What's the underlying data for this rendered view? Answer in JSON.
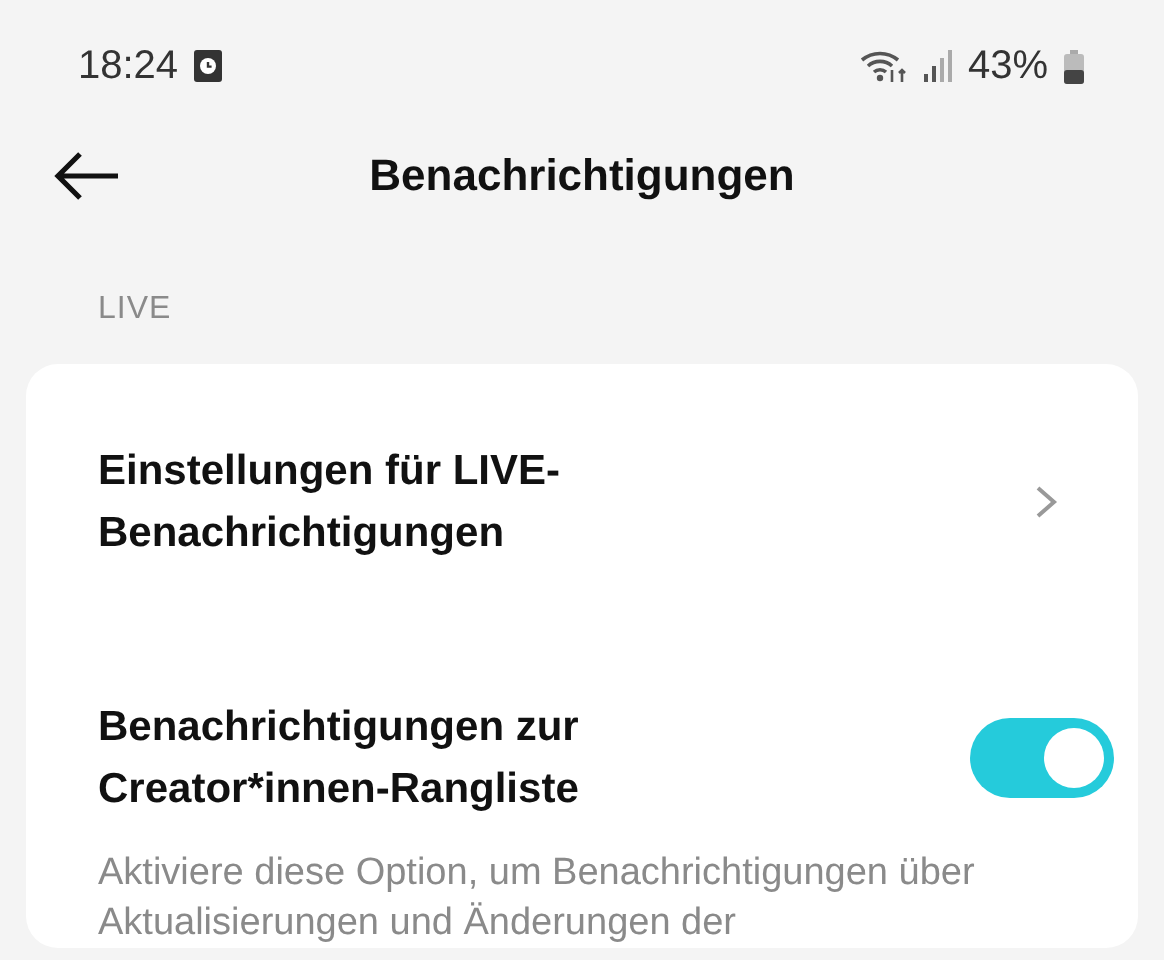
{
  "status_bar": {
    "time": "18:24",
    "battery": "43%"
  },
  "header": {
    "title": "Benachrichtigungen"
  },
  "section": {
    "label": "LIVE",
    "items": [
      {
        "kind": "link",
        "label": "Einstellungen für LIVE-Benachrichtigungen"
      },
      {
        "kind": "toggle",
        "label": "Benachrichtigungen zur Creator*innen-Rangliste",
        "on": true,
        "description": "Aktiviere diese Option, um Benachrichtigungen über Aktualisierungen und Änderungen der"
      }
    ]
  }
}
